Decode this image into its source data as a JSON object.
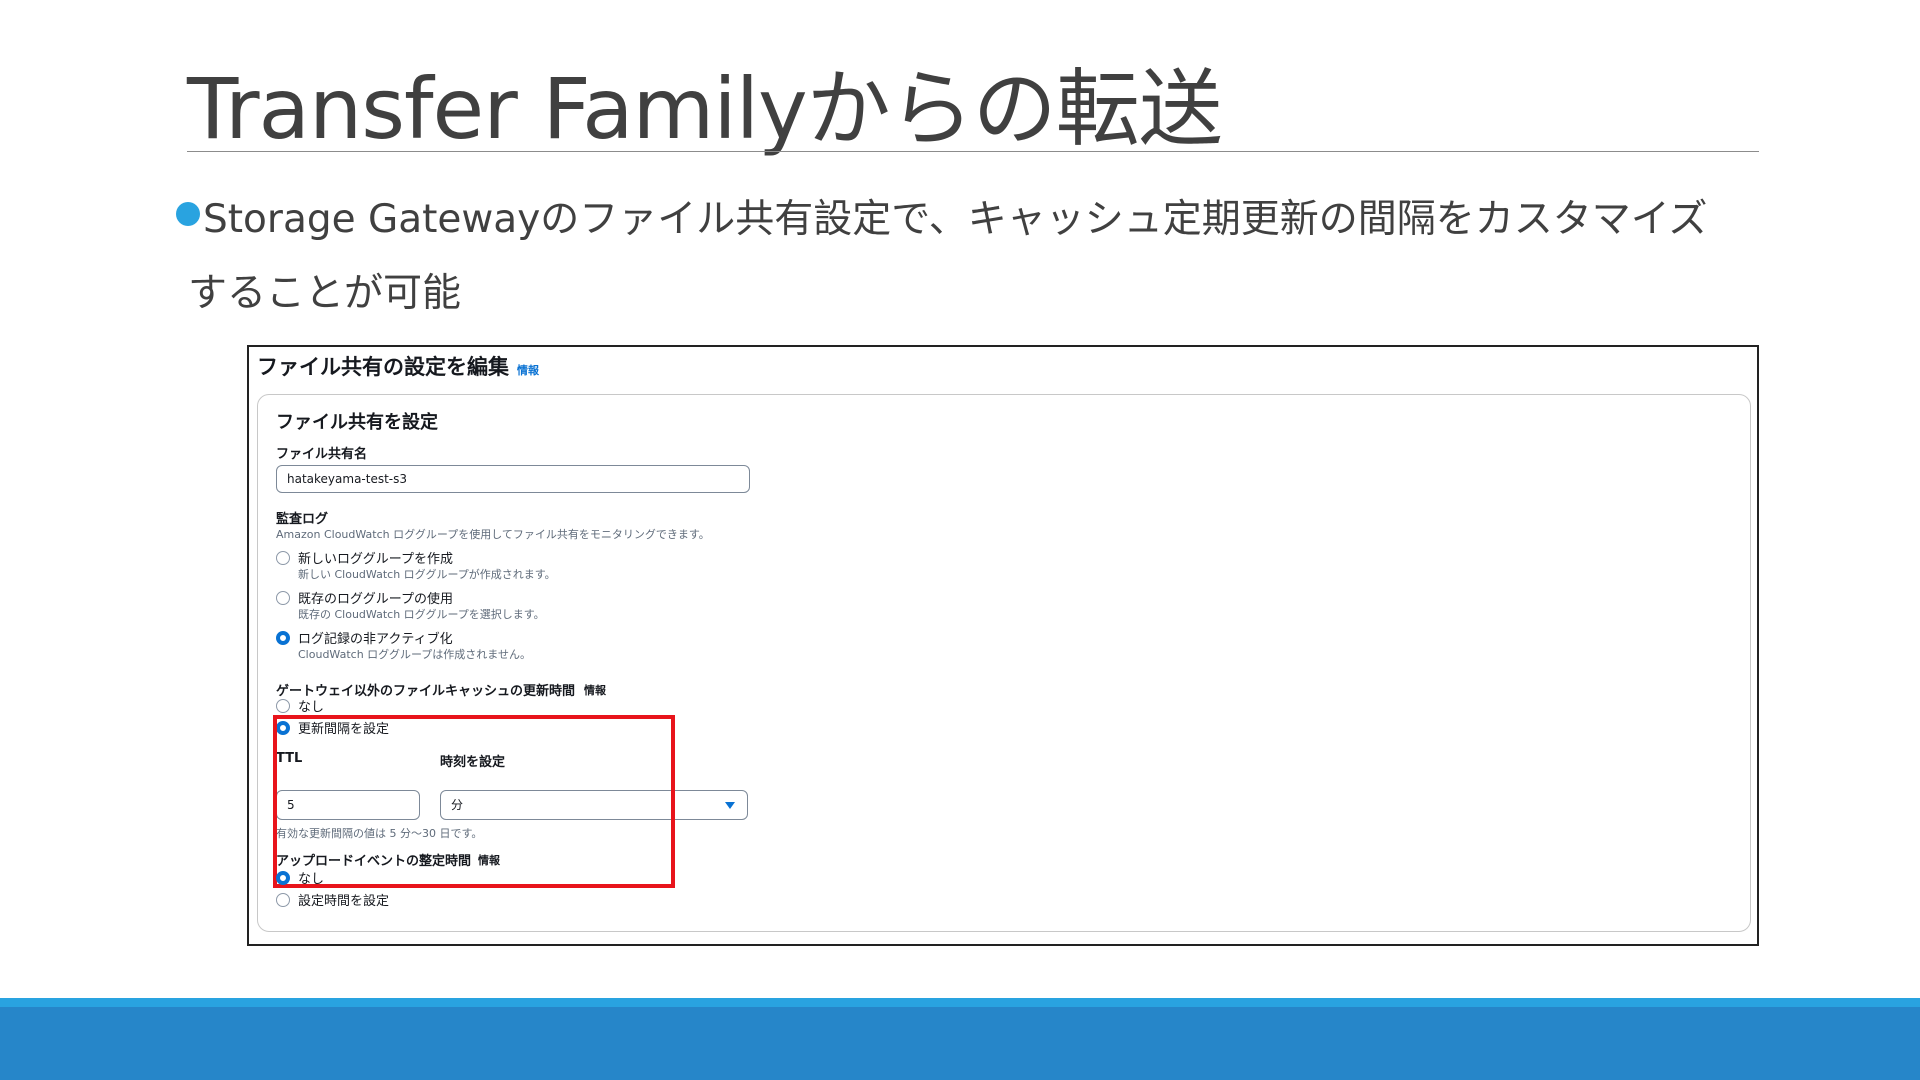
{
  "slide": {
    "title": "Transfer Familyからの転送",
    "bullet_line1": "Storage Gatewayのファイル共有設定で、キャッシュ定期更新の間隔をカスタマイズ",
    "bullet_line2": "することが可能"
  },
  "screenshot": {
    "title": "ファイル共有の設定を編集",
    "info": "情報",
    "section_title": "ファイル共有を設定",
    "file_share_name": {
      "label": "ファイル共有名",
      "value": "hatakeyama-test-s3"
    },
    "audit_log": {
      "label": "監査ログ",
      "description": "Amazon CloudWatch ロググループを使用してファイル共有をモニタリングできます。",
      "options": [
        {
          "label": "新しいロググループを作成",
          "description": "新しい CloudWatch ロググループが作成されます。",
          "selected": false
        },
        {
          "label": "既存のロググループの使用",
          "description": "既存の CloudWatch ロググループを選択します。",
          "selected": false
        },
        {
          "label": "ログ記録の非アクティブ化",
          "description": "CloudWatch ロググループは作成されません。",
          "selected": true
        }
      ]
    },
    "cache_refresh": {
      "label": "ゲートウェイ以外のファイルキャッシュの更新時間",
      "info": "情報",
      "options": [
        {
          "label": "なし",
          "selected": false
        },
        {
          "label": "更新間隔を設定",
          "selected": true
        }
      ],
      "ttl_label": "TTL",
      "ttl_value": "5",
      "unit_label": "時刻を設定",
      "unit_value": "分",
      "hint": "有効な更新間隔の値は 5 分〜30 日です。"
    },
    "upload_settle": {
      "label": "アップロードイベントの整定時間",
      "info": "情報",
      "options": [
        {
          "label": "なし",
          "selected": true
        },
        {
          "label": "設定時間を設定",
          "selected": false
        }
      ]
    }
  },
  "colors": {
    "accent_blue": "#0972d3",
    "highlight_red": "#e8141b",
    "footer_blue": "#2686c9",
    "bullet_blue": "#29a3e0"
  }
}
